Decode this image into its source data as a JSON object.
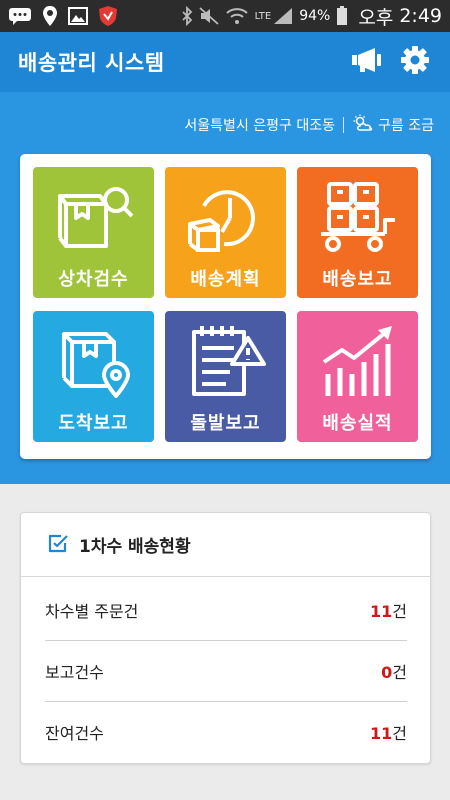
{
  "status_bar": {
    "battery": "94%",
    "ampm": "오후",
    "time": "2:49",
    "network": "LTE",
    "icons": [
      "chat-icon",
      "location-icon",
      "gallery-icon",
      "shield-app-icon",
      "bluetooth-icon",
      "mute-icon",
      "wifi-icon",
      "lte-signal-icon",
      "battery-icon"
    ]
  },
  "header": {
    "title": "배송관리 시스템",
    "actions": [
      "megaphone-icon",
      "gear-icon"
    ]
  },
  "info": {
    "location": "서울특별시 은평구 대조동",
    "weather": "구름 조금",
    "weather_icon": "cloud-sun-icon"
  },
  "menu": [
    {
      "label": "상차검수",
      "icon": "box-search-icon",
      "color": "#9fc43a"
    },
    {
      "label": "배송계획",
      "icon": "clock-box-icon",
      "color": "#f7a21b"
    },
    {
      "label": "배송보고",
      "icon": "cart-boxes-icon",
      "color": "#f26d21"
    },
    {
      "label": "도착보고",
      "icon": "box-location-icon",
      "color": "#24a9e1"
    },
    {
      "label": "돌발보고",
      "icon": "report-warning-icon",
      "color": "#4a5ba6"
    },
    {
      "label": "배송실적",
      "icon": "chart-up-icon",
      "color": "#f0609a"
    }
  ],
  "delivery_status": {
    "title": "1차수 배송현황",
    "icon": "edit-check-icon",
    "unit": "건",
    "rows": [
      {
        "label": "차수별 주문건",
        "value": "11"
      },
      {
        "label": "보고건수",
        "value": "0"
      },
      {
        "label": "잔여건수",
        "value": "11"
      }
    ]
  },
  "colors": {
    "app_bar": "#1e86d4",
    "hero": "#2a95e0",
    "accent_red": "#d01818"
  }
}
